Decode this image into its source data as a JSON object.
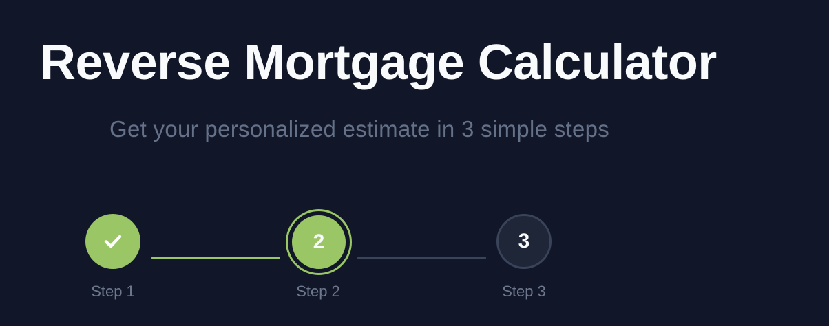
{
  "page": {
    "title": "Reverse Mortgage Calculator",
    "subtitle": "Get your personalized estimate in 3 simple steps"
  },
  "stepper": {
    "current_step": 2,
    "steps": [
      {
        "number": "1",
        "label": "Step 1",
        "status": "completed",
        "icon": "check-icon"
      },
      {
        "number": "2",
        "label": "Step 2",
        "status": "active"
      },
      {
        "number": "3",
        "label": "Step 3",
        "status": "upcoming"
      }
    ],
    "connectors": [
      {
        "status": "completed"
      },
      {
        "status": "upcoming"
      }
    ]
  },
  "colors": {
    "background": "#111728",
    "title": "#f8fafc",
    "subtitle": "#657189",
    "accent": "#9ac666",
    "inactive_circle": "#1e2638",
    "inactive_border": "#39435a",
    "step_label": "#6d788f"
  }
}
